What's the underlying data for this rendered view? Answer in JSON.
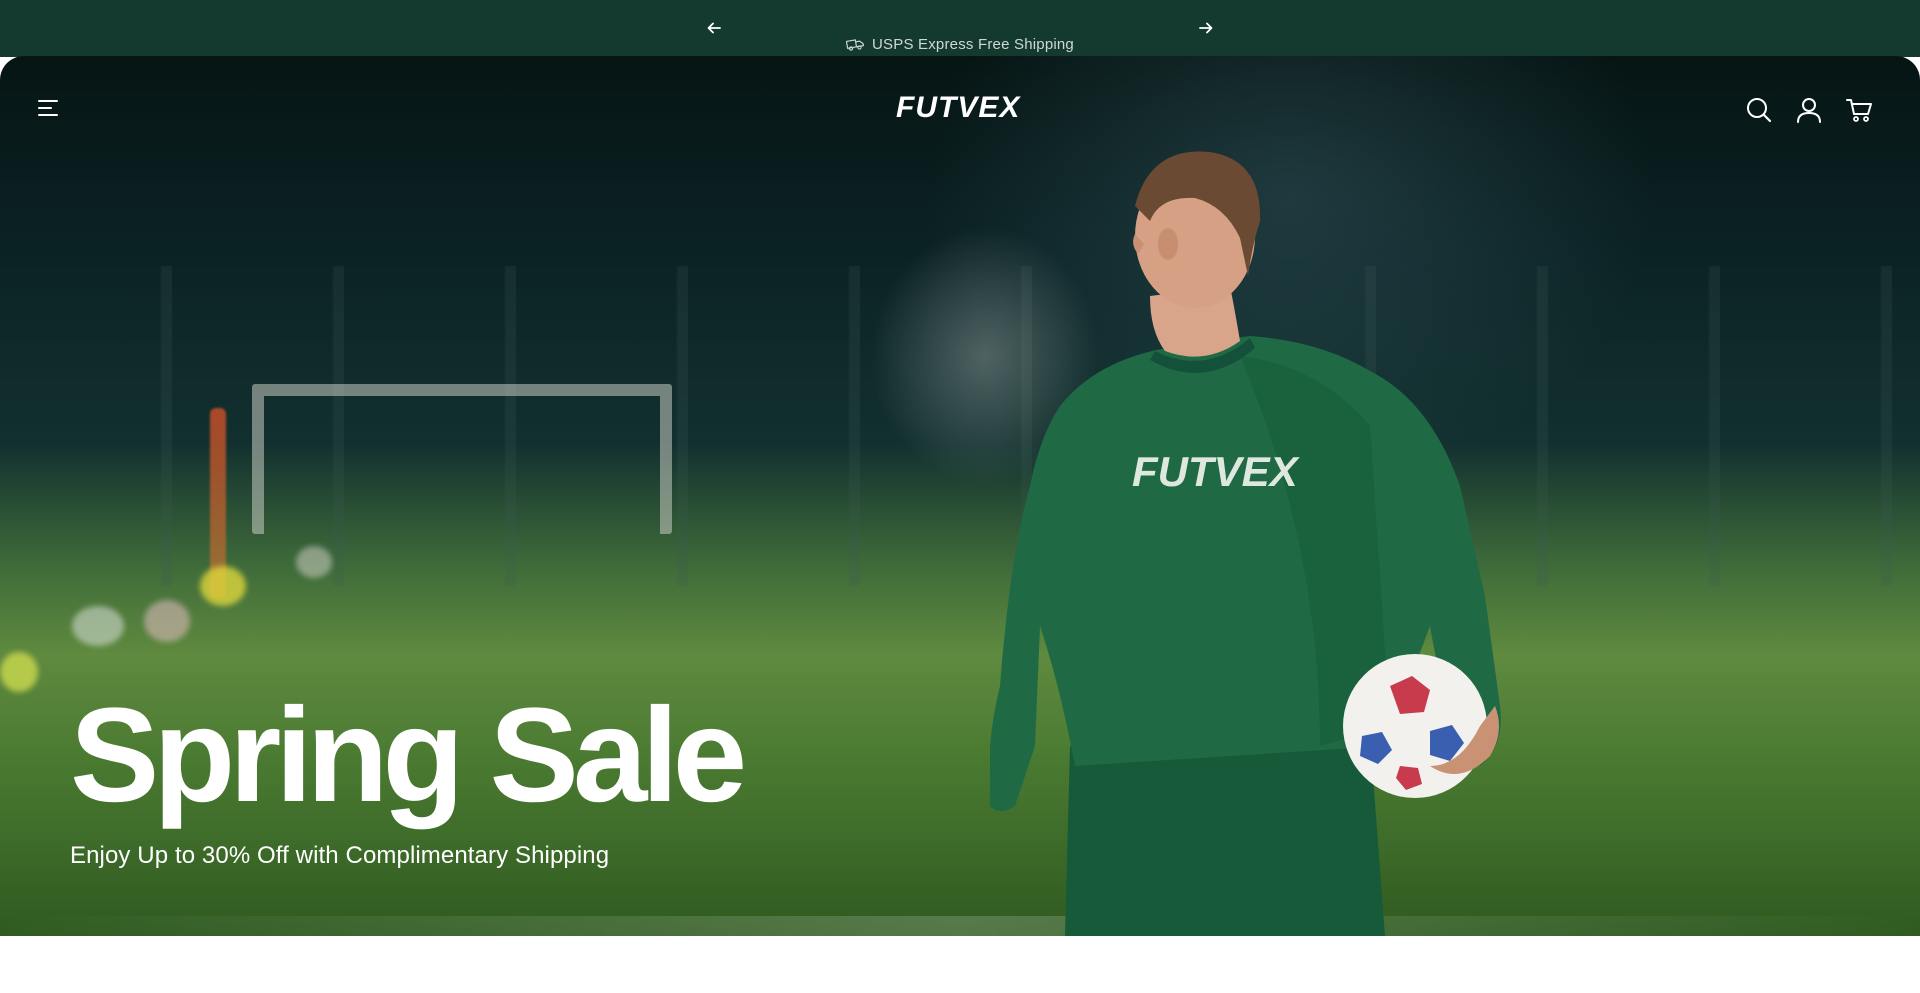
{
  "announcement": {
    "message": "USPS Express Free Shipping",
    "icons": {
      "prev": "arrow-left-icon",
      "next": "arrow-right-icon",
      "shipping": "truck-icon"
    }
  },
  "header": {
    "brand": "FUTVEX",
    "icons": [
      "menu-icon",
      "search-icon",
      "account-icon",
      "cart-icon"
    ]
  },
  "hero": {
    "title": "Spring Sale",
    "subtitle": "Enjoy Up to 30% Off with Complimentary Shipping",
    "jersey_brand": "FUTVEX"
  },
  "colors": {
    "announcement_bg": "#14392e",
    "jersey_green": "#1f6a45",
    "text": "#ffffff"
  }
}
